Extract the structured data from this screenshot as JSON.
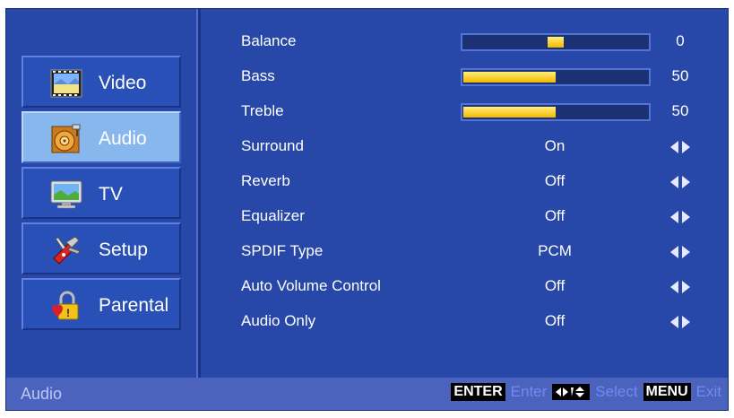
{
  "sidebar": {
    "items": [
      {
        "label": "Video",
        "icon": "video-icon"
      },
      {
        "label": "Audio",
        "icon": "audio-icon",
        "active": true
      },
      {
        "label": "TV",
        "icon": "tv-icon"
      },
      {
        "label": "Setup",
        "icon": "setup-icon"
      },
      {
        "label": "Parental",
        "icon": "parental-lock-icon"
      }
    ]
  },
  "settings": {
    "balance": {
      "label": "Balance",
      "value": "0",
      "level_percent": 50
    },
    "bass": {
      "label": "Bass",
      "value": "50",
      "level_percent": 50
    },
    "treble": {
      "label": "Treble",
      "value": "50",
      "level_percent": 50
    },
    "surround": {
      "label": "Surround",
      "value": "On"
    },
    "reverb": {
      "label": "Reverb",
      "value": "Off"
    },
    "equalizer": {
      "label": "Equalizer",
      "value": "Off"
    },
    "spdif": {
      "label": "SPDIF Type",
      "value": "PCM"
    },
    "avc": {
      "label": "Auto Volume Control",
      "value": "Off"
    },
    "audio_only": {
      "label": "Audio Only",
      "value": "Off"
    }
  },
  "footer": {
    "title": "Audio",
    "enter_key": "ENTER",
    "enter_hint": "Enter",
    "select_hint": "Select",
    "menu_key": "MENU",
    "exit_hint": "Exit"
  },
  "colors": {
    "background": "#2748a8",
    "active_item": "#88b7ee",
    "slider_fill": "#f5c400",
    "footer": "#4c63bd"
  }
}
